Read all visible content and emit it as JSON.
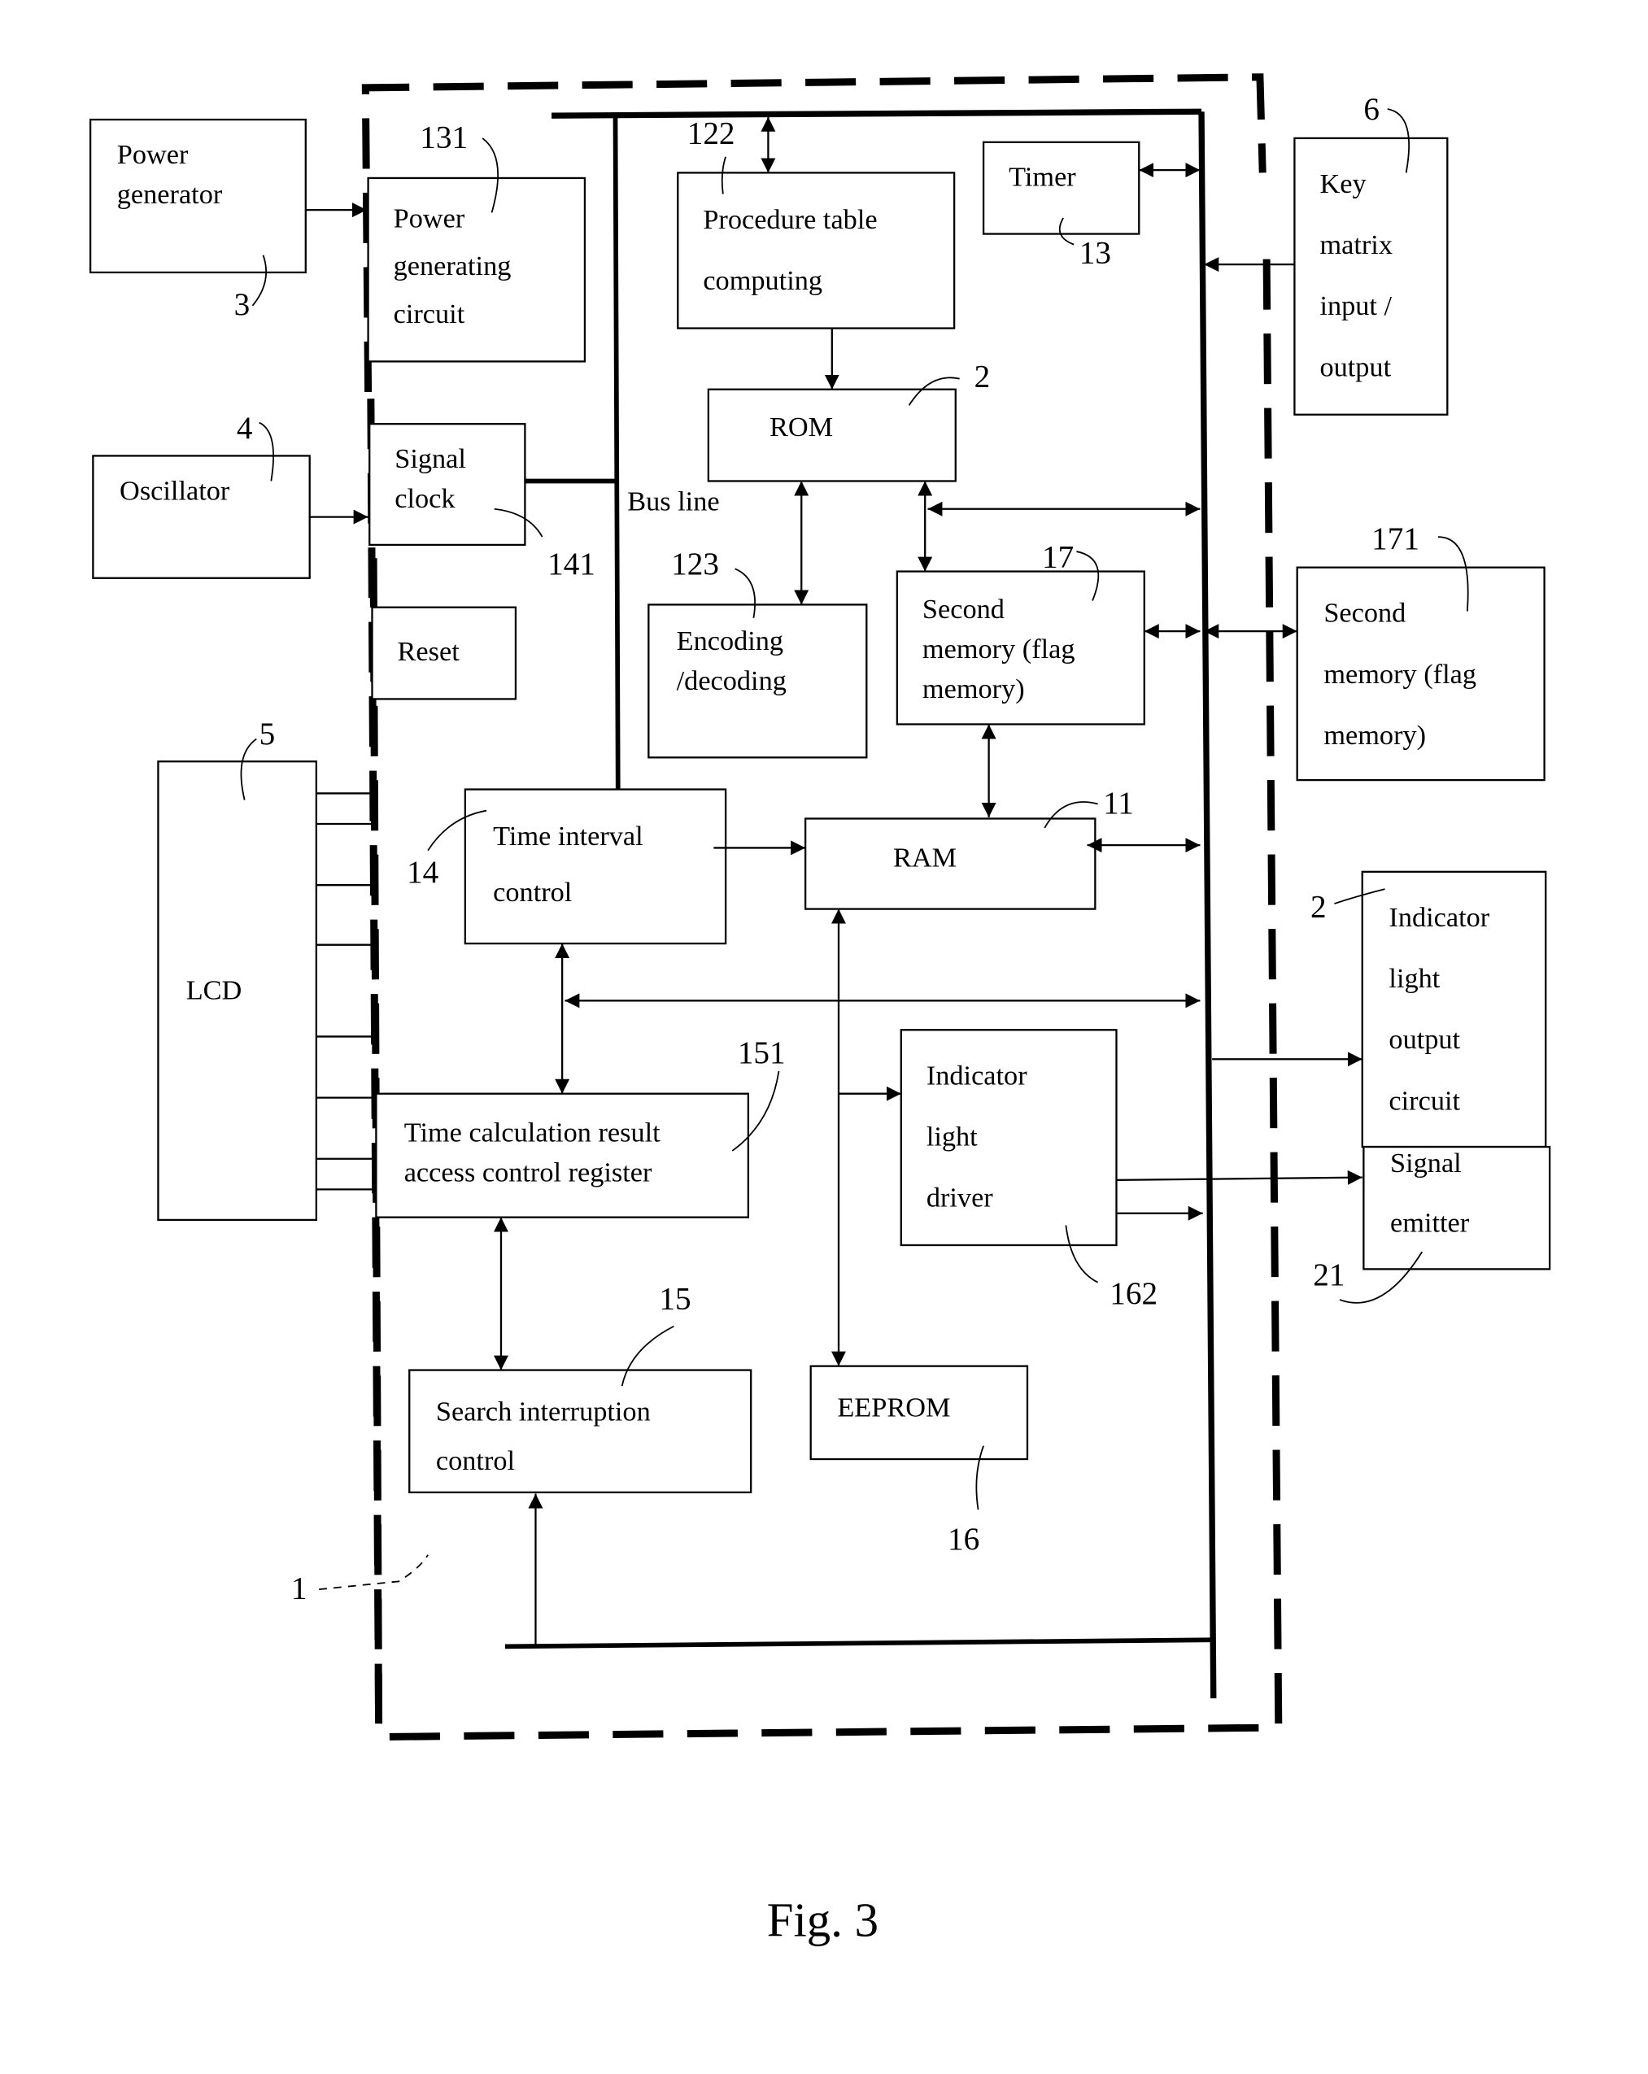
{
  "figure": {
    "caption": "Fig. 3",
    "bus_label": "Bus line",
    "colors": {
      "ink": "#000000",
      "paper": "#ffffff"
    }
  },
  "blocks": {
    "power_generator": {
      "lines": [
        "Power",
        "generator"
      ],
      "ref": "3"
    },
    "power_generating_circuit": {
      "lines": [
        "Power",
        "generating",
        "circuit"
      ],
      "ref": "131"
    },
    "oscillator": {
      "lines": [
        "Oscillator"
      ],
      "ref": "4"
    },
    "signal_clock": {
      "lines": [
        "Signal",
        "clock"
      ],
      "ref": "141"
    },
    "reset": {
      "lines": [
        "Reset"
      ]
    },
    "procedure_table": {
      "lines": [
        "Procedure table",
        "computing"
      ],
      "ref": "122"
    },
    "timer": {
      "lines": [
        "Timer"
      ],
      "ref": "13"
    },
    "rom": {
      "lines": [
        "ROM"
      ],
      "ref": "2"
    },
    "encoding_decoding": {
      "lines": [
        "Encoding",
        "/decoding"
      ],
      "ref": "123"
    },
    "second_memory_internal": {
      "lines": [
        "Second",
        "memory (flag",
        "memory)"
      ],
      "ref": "17"
    },
    "key_matrix": {
      "lines": [
        "Key",
        "matrix",
        "input /",
        "output"
      ],
      "ref": "6"
    },
    "second_memory_external": {
      "lines": [
        "Second",
        "memory (flag",
        "memory)"
      ],
      "ref": "171"
    },
    "lcd": {
      "lines": [
        "LCD"
      ],
      "ref": "5"
    },
    "time_interval_control": {
      "lines": [
        "Time interval",
        "control"
      ],
      "ref": "14"
    },
    "ram": {
      "lines": [
        "RAM"
      ],
      "ref": "11"
    },
    "time_calc_register": {
      "lines": [
        "Time calculation result",
        "access control register"
      ],
      "ref": "151"
    },
    "indicator_light_driver": {
      "lines": [
        "Indicator",
        "light",
        "driver"
      ],
      "ref": "162"
    },
    "search_interruption_control": {
      "lines": [
        "Search interruption",
        "control"
      ],
      "ref": "15"
    },
    "eeprom": {
      "lines": [
        "EEPROM"
      ],
      "ref": "16"
    },
    "indicator_light_output": {
      "lines": [
        "Indicator",
        "light",
        "output",
        "circuit"
      ],
      "ref": "2"
    },
    "signal_emitter": {
      "lines": [
        "Signal",
        "emitter"
      ],
      "ref": "21"
    },
    "chip": {
      "ref": "1"
    }
  }
}
